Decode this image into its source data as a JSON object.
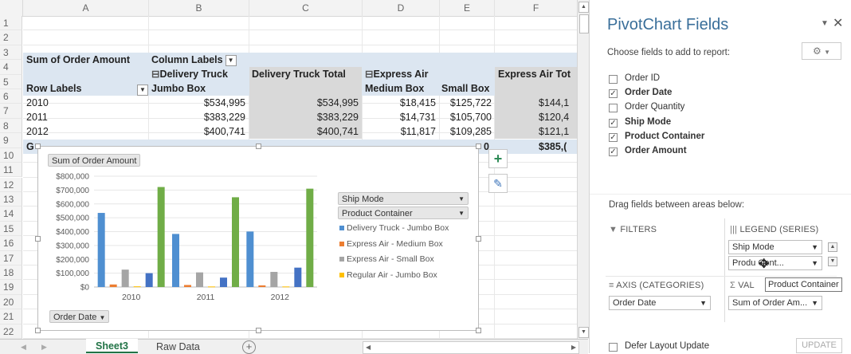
{
  "columns": [
    "A",
    "B",
    "C",
    "D",
    "E",
    "F"
  ],
  "rows": [
    "1",
    "2",
    "3",
    "4",
    "5",
    "6",
    "7",
    "8",
    "9",
    "10",
    "11",
    "12",
    "13",
    "14",
    "15",
    "16",
    "17",
    "18",
    "19",
    "20",
    "21",
    "22"
  ],
  "pivot": {
    "sum_label": "Sum of Order Amount",
    "col_labels": "Column Labels",
    "dt_header": "Delivery Truck",
    "dt_total": "Delivery Truck Total",
    "ea_header": "Express Air",
    "ea_total": "Express Air Tot",
    "row_labels": "Row Labels",
    "jumbo": "Jumbo Box",
    "medium": "Medium Box",
    "small": "Small Box",
    "data": [
      {
        "year": "2010",
        "b": "$534,995",
        "c": "$534,995",
        "d": "$18,415",
        "e": "$125,722",
        "f": "$144,1"
      },
      {
        "year": "2011",
        "b": "$383,229",
        "c": "$383,229",
        "d": "$14,731",
        "e": "$105,700",
        "f": "$120,4"
      },
      {
        "year": "2012",
        "b": "$400,741",
        "c": "$400,741",
        "d": "$11,817",
        "e": "$109,285",
        "f": "$121,1"
      }
    ],
    "grand_partial": "G",
    "grand_e_partial": "0",
    "grand_f": "$385,("
  },
  "chart": {
    "sum_button": "Sum of Order Amount",
    "order_date_button": "Order Date",
    "ship_mode_button": "Ship Mode",
    "product_container_button": "Product Container"
  },
  "chart_data": {
    "type": "bar",
    "categories": [
      "2010",
      "2011",
      "2012"
    ],
    "ylim": [
      0,
      800000
    ],
    "yticks": [
      "$800,000",
      "$700,000",
      "$600,000",
      "$500,000",
      "$400,000",
      "$300,000",
      "$200,000",
      "$100,000",
      "$0"
    ],
    "series": [
      {
        "name": "Delivery Truck - Jumbo Box",
        "color": "#4f8fd1",
        "values": [
          534995,
          383229,
          400741
        ]
      },
      {
        "name": "Express Air - Medium Box",
        "color": "#ec7d31",
        "values": [
          18415,
          14731,
          11817
        ]
      },
      {
        "name": "Express Air - Small Box",
        "color": "#a5a5a5",
        "values": [
          125722,
          105700,
          109285
        ]
      },
      {
        "name": "Regular Air - Jumbo Box",
        "color": "#ffc000",
        "values": [
          5000,
          4000,
          4000
        ]
      },
      {
        "name": "",
        "color": "#4472c4",
        "values": [
          100000,
          68000,
          140000
        ]
      },
      {
        "name": "",
        "color": "#70ad47",
        "values": [
          722000,
          648000,
          710000
        ]
      }
    ],
    "legend_position": "right"
  },
  "tabs": {
    "sheet3": "Sheet3",
    "raw": "Raw Data",
    "add": "+"
  },
  "pane": {
    "title": "PivotChart Fields",
    "choose": "Choose fields to add to report:",
    "fields": [
      {
        "label": "Order ID",
        "checked": false
      },
      {
        "label": "Order Date",
        "checked": true
      },
      {
        "label": "Order Quantity",
        "checked": false
      },
      {
        "label": "Ship Mode",
        "checked": true
      },
      {
        "label": "Product Container",
        "checked": true
      },
      {
        "label": "Order Amount",
        "checked": true
      }
    ],
    "drag_label": "Drag fields between areas below:",
    "filters": "FILTERS",
    "legend": "LEGEND (SERIES)",
    "axis": "AXIS (CATEGORIES)",
    "values": "VAL",
    "legend_items": [
      "Ship Mode",
      "Produ  Cont..."
    ],
    "axis_item": "Order Date",
    "values_item": "Sum of Order Am...",
    "tooltip": "Product Container",
    "defer": "Defer Layout Update",
    "update": "UPDATE"
  }
}
